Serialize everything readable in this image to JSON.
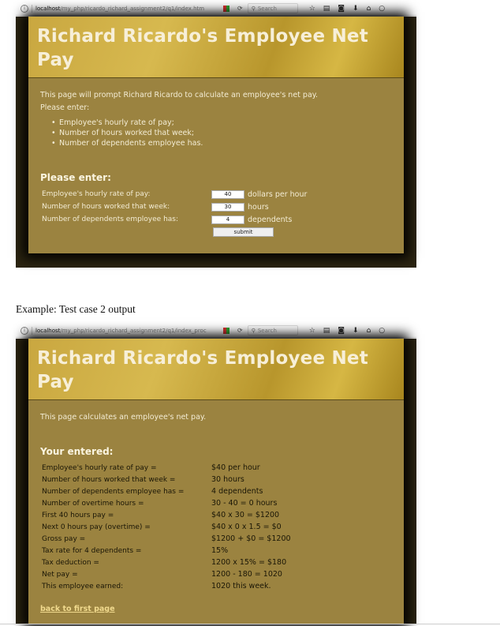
{
  "screen1": {
    "url_host": "localhost",
    "url_path": "/my_php/ricardo_richard_assignment2/q1/index.htm",
    "search_placeholder": "Search",
    "title": "Richard Ricardo's Employee Net Pay",
    "intro": "This page will prompt Richard Ricardo to calculate an employee's net pay.",
    "please_enter": "Please enter:",
    "bullets": [
      "Employee's hourly rate of pay;",
      "Number of hours worked that week;",
      "Number of dependents employee has."
    ],
    "form_heading": "Please enter:",
    "fields": [
      {
        "label": "Employee's hourly rate of pay:",
        "value": "40",
        "unit": "dollars per hour"
      },
      {
        "label": "Number of hours worked that week:",
        "value": "30",
        "unit": "hours"
      },
      {
        "label": "Number of dependents employee has:",
        "value": "4",
        "unit": "dependents"
      }
    ],
    "submit_label": "submit"
  },
  "caption": "Example: Test case 2 output",
  "screen2": {
    "url_host": "localhost",
    "url_path": "/my_php/ricardo_richard_assignment2/q1/index_proc",
    "search_placeholder": "Search",
    "title": "Richard Ricardo's Employee Net Pay",
    "intro": "This page calculates an employee's net pay.",
    "heading": "Your entered:",
    "rows": [
      {
        "label": "Employee's hourly rate of pay =",
        "value": "$40 per hour"
      },
      {
        "label": "Number of hours worked that week =",
        "value": "30 hours"
      },
      {
        "label": "Number of dependents employee has =",
        "value": "4 dependents"
      },
      {
        "label": "Number of overtime hours =",
        "value": "30 - 40 = 0 hours"
      },
      {
        "label": "First 40 hours pay =",
        "value": "$40 x 30 = $1200"
      },
      {
        "label": "Next 0 hours pay (overtime) =",
        "value": "$40 x 0 x 1.5 = $0"
      },
      {
        "label": "Gross pay =",
        "value": "$1200 + $0 = $1200"
      },
      {
        "label": "Tax rate for 4 dependents =",
        "value": "15%"
      },
      {
        "label": "Tax deduction =",
        "value": "1200 x 15% = $180"
      },
      {
        "label": "Net pay =",
        "value": "1200 - 180 = 1020"
      },
      {
        "label": "This employee earned:",
        "value": "1020 this week."
      }
    ],
    "back_link": "back to first page"
  }
}
